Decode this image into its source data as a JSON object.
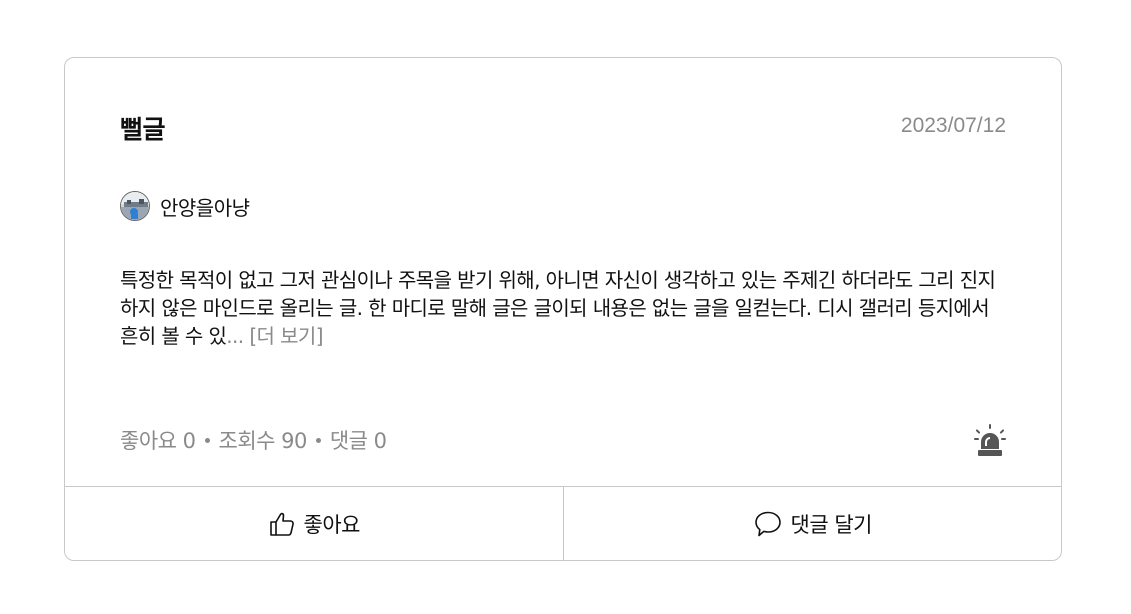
{
  "post": {
    "title": "뻘글",
    "date": "2023/07/12",
    "author": "안양을아냥",
    "content": "특정한 목적이 없고 그저 관심이나 주목을 받기 위해, 아니면 자신이 생각하고 있는 주제긴 하더라도 그리 진지하지 않은 마인드로 올리는 글. 한 마디로 말해 글은 글이되 내용은 없는 글을 일컫는다. 디시 갤러리 등지에서 흔히 볼 수 있",
    "ellipsis": "...",
    "more_label": "[더 보기]"
  },
  "stats": {
    "likes": "좋아요 0",
    "views": "조회수 90",
    "comments": "댓글 0"
  },
  "actions": {
    "like_label": "좋아요",
    "comment_label": "댓글 달기"
  },
  "icons": {
    "avatar": "avatar-image",
    "report": "siren-icon",
    "like": "thumbs-up-icon",
    "comment": "speech-bubble-icon"
  },
  "colors": {
    "muted_text": "#8a8a8a",
    "border": "#c9c9c9",
    "icon": "#555555"
  }
}
